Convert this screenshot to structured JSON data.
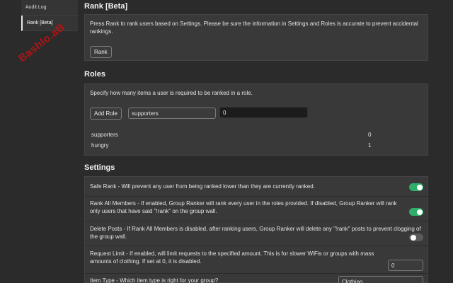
{
  "nav": {
    "items": [
      {
        "label": "Audit Log",
        "active": false
      },
      {
        "label": "Rank [Beta]",
        "active": true
      }
    ],
    "stamp": "Bashlo.aB"
  },
  "rank": {
    "title": "Rank [Beta]",
    "description": "Press Rank to rank users based on Settings. Please be sure the information in Settings and Roles is accurate to prevent accidental rankings.",
    "button": "Rank"
  },
  "roles": {
    "title": "Roles",
    "description": "Specify how many items a user is required to be ranked in a role.",
    "add_button": "Add Role",
    "name_value": "supporters",
    "count_value": "0",
    "list": [
      {
        "name": "supporters",
        "count": "0"
      },
      {
        "name": "hungry",
        "count": "1"
      }
    ]
  },
  "settings": {
    "title": "Settings",
    "safe_rank": {
      "text": "Safe Rank - Will prevent any user from being ranked lower than they are currently ranked.",
      "enabled": true
    },
    "rank_all": {
      "text": "Rank All Members - If enabled, Group Ranker will rank every user in the roles provided. If disabled, Group Ranker will rank only users that have said \"!rank\" on the group wall.",
      "enabled": true
    },
    "delete_posts": {
      "text": "Delete Posts - If Rank All Members is disabled, after ranking users, Group Ranker will delete any \"!rank\" posts to prevent clogging of the group wall.",
      "enabled": false
    },
    "request_limit": {
      "text": "Request Limit - If enabled, will limit requests to the specified amount. This is for slower WiFis or groups with mass amounts of clothing. If set at 0, it is disabled.",
      "value": "0"
    },
    "item_type": {
      "text": "Item Type - Which item type is right for your group?",
      "value": "Clothing"
    }
  },
  "colors": {
    "toggle_on": "#2fae6a",
    "toggle_off": "#5a5a5a",
    "stamp": "#c81010"
  }
}
